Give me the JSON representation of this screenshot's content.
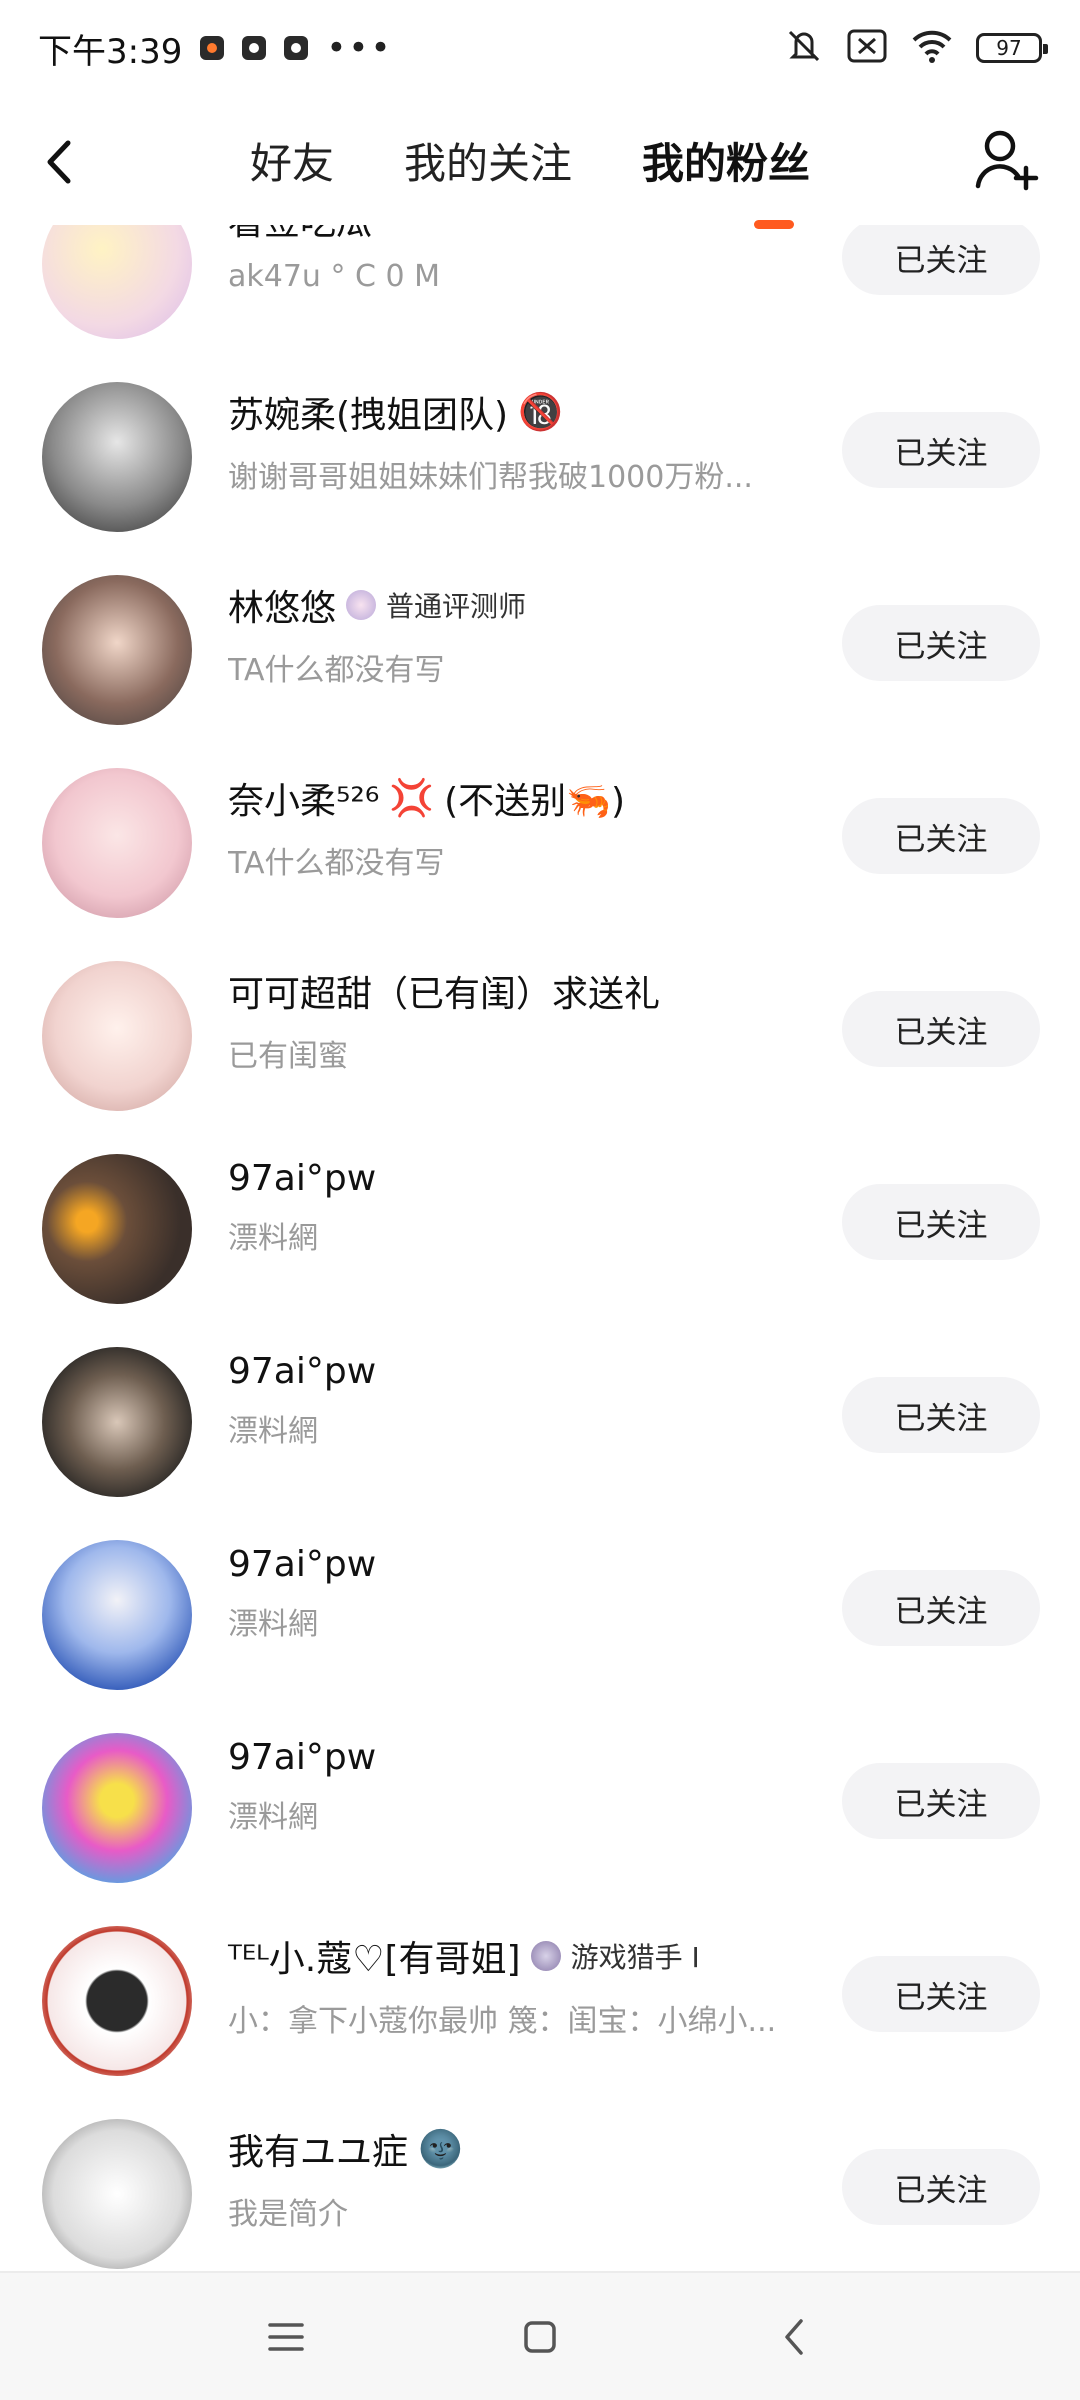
{
  "status_bar": {
    "time": "下午3:39",
    "more": "•••",
    "battery": "97"
  },
  "header": {
    "tabs": [
      {
        "label": "好友",
        "active": false
      },
      {
        "label": "我的关注",
        "active": false
      },
      {
        "label": "我的粉丝",
        "active": true
      }
    ]
  },
  "colors": {
    "accent": "#ff5a1f",
    "button_bg": "#f3f3f5",
    "desc_gray": "#9a9a9a"
  },
  "fans": [
    {
      "name": "看签吃瓜",
      "desc": "ak47u ° C 0 M",
      "button": "已关注",
      "avatar_color": "#f3d9e4"
    },
    {
      "name": "苏婉柔(拽姐团队)",
      "emoji": "🔞",
      "desc": "谢谢哥哥姐姐妹妹们帮我破1000万粉...",
      "button": "已关注",
      "avatar_color": "#555555"
    },
    {
      "name": "林悠悠",
      "badge": "普通评测师",
      "desc": "TA什么都没有写",
      "button": "已关注",
      "avatar_color": "#8a6a5e"
    },
    {
      "name": "奈小柔⁵²⁶",
      "extra": "(不送别🦐)",
      "emoji": "💢",
      "desc": "TA什么都没有写",
      "button": "已关注",
      "avatar_color": "#f2c7cf"
    },
    {
      "name": "可可超甜（已有闺）求送礼",
      "desc": "已有闺蜜",
      "button": "已关注",
      "avatar_color": "#f1d3cf"
    },
    {
      "name": "97ai°pw",
      "desc": "漂料網",
      "button": "已关注",
      "avatar_color": "#3a2f2a"
    },
    {
      "name": "97ai°pw",
      "desc": "漂料網",
      "button": "已关注",
      "avatar_color": "#2e2b28"
    },
    {
      "name": "97ai°pw",
      "desc": "漂料網",
      "button": "已关注",
      "avatar_color": "#4b7fd9"
    },
    {
      "name": "97ai°pw",
      "desc": "漂料網",
      "button": "已关注",
      "avatar_color": "#e85bc7"
    },
    {
      "name": "ᵀᴱᴸ小.蔻♡[有哥姐]",
      "badge": "游戏猎手 I",
      "desc": "小：拿下小蔻你最帅 篾：闺宝：小绵小...",
      "button": "已关注",
      "avatar_color": "#c0392b"
    },
    {
      "name": "我有ユユ症",
      "emoji": "🌚",
      "desc": "我是简介",
      "button": "已关注",
      "avatar_color": "#eeeeee"
    }
  ]
}
